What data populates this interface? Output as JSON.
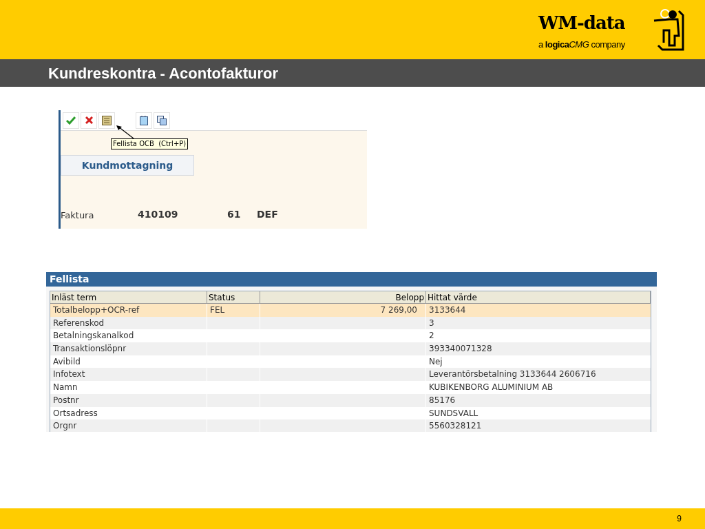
{
  "slide": {
    "title": "Kundreskontra - Acontofakturor",
    "page_number": "9"
  },
  "logo": {
    "name": "WM-data",
    "tagline_prefix": "a",
    "tagline_brand": "logica",
    "tagline_brand_2": "CMG",
    "tagline_suffix": "company"
  },
  "app_screen": {
    "toolbar": [
      {
        "kind": "check"
      },
      {
        "kind": "cancel"
      },
      {
        "kind": "list"
      },
      {
        "kind": "page"
      },
      {
        "kind": "copy"
      }
    ],
    "tooltip": "Fellista OCB  (Ctrl+P)",
    "tab": "Kundmottagning",
    "fields": [
      "Faktura",
      "410109",
      "61",
      "DEF"
    ]
  },
  "error_list": {
    "title": "Fellista",
    "columns": [
      {
        "label": "Inläst term",
        "kind": "text"
      },
      {
        "label": "Status",
        "kind": "text"
      },
      {
        "label": "Belopp",
        "kind": "number"
      },
      {
        "label": "Hittat värde",
        "kind": "text"
      }
    ],
    "rows": [
      {
        "cells": [
          "Totalbelopp+OCR-ref",
          "FEL",
          "7 269,00",
          "3133644"
        ],
        "selected": true
      },
      {
        "cells": [
          "Referenskod",
          "",
          "",
          "3"
        ],
        "selected": false
      },
      {
        "cells": [
          "Betalningskanalkod",
          "",
          "",
          "2"
        ],
        "selected": false
      },
      {
        "cells": [
          "Transaktionslöpnr",
          "",
          "",
          "393340071328"
        ],
        "selected": false
      },
      {
        "cells": [
          "Avibild",
          "",
          "",
          "Nej"
        ],
        "selected": false
      },
      {
        "cells": [
          "Infotext",
          "",
          "",
          "Leverantörsbetalning 3133644 2606716"
        ],
        "selected": false
      },
      {
        "cells": [
          "Namn",
          "",
          "",
          "KUBIKENBORG ALUMINIUM AB"
        ],
        "selected": false
      },
      {
        "cells": [
          "Postnr",
          "",
          "",
          "85176"
        ],
        "selected": false
      },
      {
        "cells": [
          "Ortsadress",
          "",
          "",
          "SUNDSVALL"
        ],
        "selected": false
      },
      {
        "cells": [
          "Orgnr",
          "",
          "",
          "5560328121"
        ],
        "selected": false
      }
    ]
  }
}
